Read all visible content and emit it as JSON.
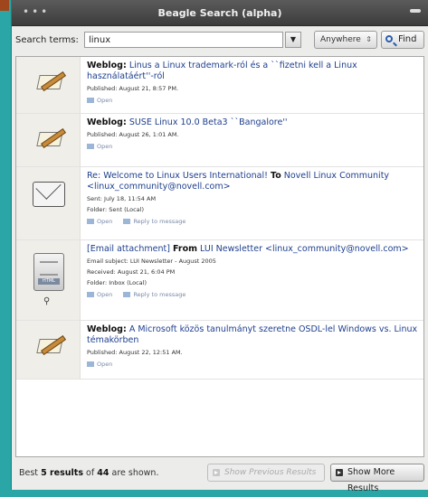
{
  "window": {
    "title": "Beagle Search (alpha)"
  },
  "search": {
    "label": "Search terms:",
    "value": "linux",
    "scope": "Anywhere",
    "find_label": "Find"
  },
  "results": [
    {
      "type": "Weblog:",
      "title": "Linus a Linux trademark-ról és a ``fizetni kell a Linux használatáért''-ról",
      "meta": [
        "Published: August 21, 8:57 PM."
      ],
      "actions": [
        "Open"
      ]
    },
    {
      "type": "Weblog:",
      "title": "SUSE Linux 10.0 Beta3 ``Bangalore''",
      "meta": [
        "Published: August 26, 1:01 AM."
      ],
      "actions": [
        "Open"
      ]
    },
    {
      "title": "Re: Welcome to Linux Users International!",
      "to_label": "To",
      "to": "Novell Linux Community <linux_community@novell.com>",
      "meta": [
        "Sent: July 18, 11:54 AM",
        "Folder: Sent (Local)"
      ],
      "actions": [
        "Open",
        "Reply to message"
      ]
    },
    {
      "type": "[Email attachment]",
      "from_label": "From",
      "title": "LUI Newsletter <linux_community@novell.com>",
      "meta": [
        "Email subject: LUI Newsletter - August 2005",
        "Received: August 21, 6:04 PM",
        "Folder: Inbox (Local)"
      ],
      "actions": [
        "Open",
        "Reply to message"
      ]
    },
    {
      "type": "Weblog:",
      "title": "A Microsoft közös tanulmányt szeretne OSDL-lel Windows vs. Linux témakörben",
      "meta": [
        "Published: August 22, 12:51 AM."
      ],
      "actions": [
        "Open"
      ]
    }
  ],
  "footer": {
    "best": "Best",
    "count": "5 results",
    "of": "of",
    "total": "44",
    "shown": "are shown.",
    "prev_label": "Show Previous Results",
    "next_label": "Show More Results"
  }
}
